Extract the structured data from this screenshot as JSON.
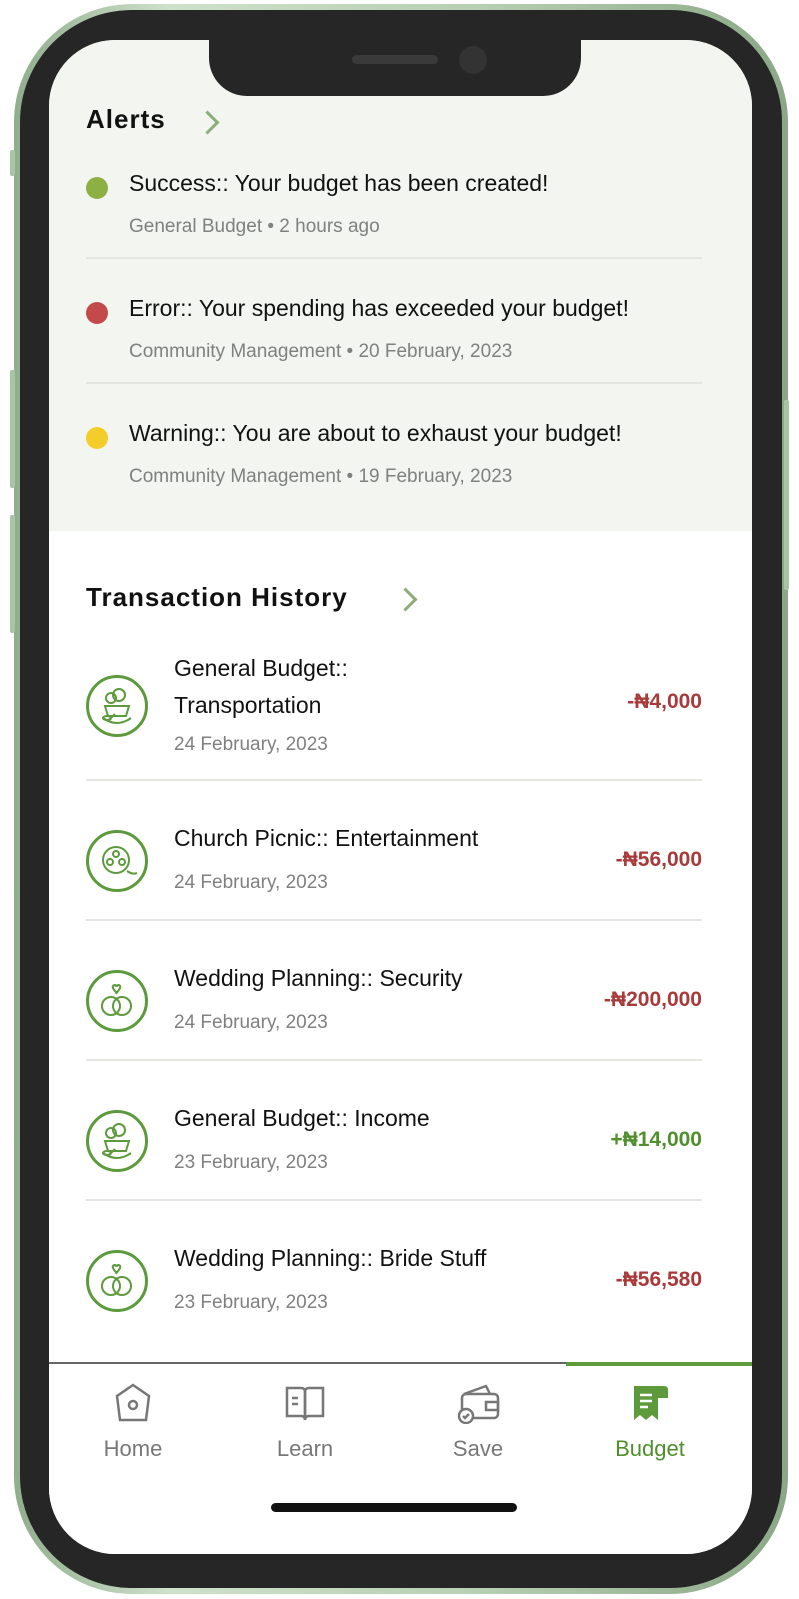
{
  "alerts": {
    "title": "Alerts",
    "items": [
      {
        "title": "Success:: Your budget has been created!",
        "meta": "General Budget  •  2 hours ago",
        "color": "#8cb043"
      },
      {
        "title": "Error:: Your spending has exceeded your budget!",
        "meta": "Community Management  •  20 February, 2023",
        "color": "#c24a4a"
      },
      {
        "title": "Warning:: You are about to exhaust your budget!",
        "meta": "Community Management  •  19 February, 2023",
        "color": "#f4cd2a"
      }
    ]
  },
  "transactions": {
    "title": "Transaction History",
    "items": [
      {
        "title": "General Budget::\nTransportation",
        "date": "24 February, 2023",
        "amount": "-₦4,000",
        "type": "debit",
        "icon": "food-basket-icon"
      },
      {
        "title": "Church Picnic:: Entertainment",
        "date": "24 February, 2023",
        "amount": "-₦56,000",
        "type": "debit",
        "icon": "film-reel-icon"
      },
      {
        "title": "Wedding Planning:: Security",
        "date": "24 February, 2023",
        "amount": "-₦200,000",
        "type": "debit",
        "icon": "wedding-rings-icon"
      },
      {
        "title": "General Budget:: Income",
        "date": "23 February, 2023",
        "amount": "+₦14,000",
        "type": "credit",
        "icon": "food-basket-icon"
      },
      {
        "title": "Wedding Planning:: Bride Stuff",
        "date": "23 February, 2023",
        "amount": "-₦56,580",
        "type": "debit",
        "icon": "wedding-rings-icon"
      }
    ]
  },
  "tabs": [
    {
      "label": "Home",
      "icon": "home-icon",
      "active": false
    },
    {
      "label": "Learn",
      "icon": "book-icon",
      "active": false
    },
    {
      "label": "Save",
      "icon": "wallet-icon",
      "active": false
    },
    {
      "label": "Budget",
      "icon": "budget-receipt-icon",
      "active": true
    }
  ],
  "colors": {
    "accent": "#5c9a3c",
    "debit": "#a83a3a",
    "credit": "#4f8f2c",
    "alerts_background": "#f3f5f0"
  }
}
